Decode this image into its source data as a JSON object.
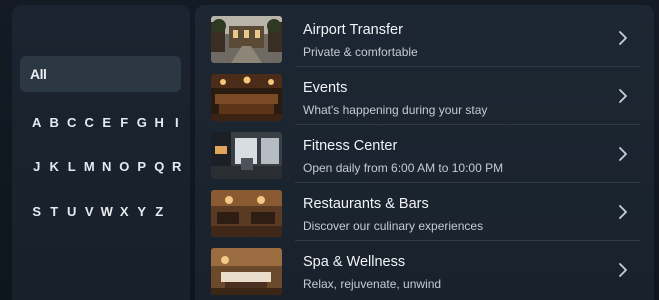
{
  "filter": {
    "all_label": "All",
    "rows": [
      [
        "A",
        "B",
        "C",
        "C",
        "E",
        "F",
        "G",
        "H",
        "I"
      ],
      [
        "J",
        "K",
        "L",
        "M",
        "N",
        "O",
        "P",
        "Q",
        "R"
      ],
      [
        "S",
        "T",
        "U",
        "V",
        "W",
        "X",
        "Y",
        "Z"
      ]
    ]
  },
  "items": [
    {
      "title": "Airport Transfer",
      "subtitle": "Private & comfortable",
      "thumb_icon": "hotel-courtyard-photo"
    },
    {
      "title": "Events",
      "subtitle": "What's happening during your stay",
      "thumb_icon": "ballroom-photo"
    },
    {
      "title": "Fitness Center",
      "subtitle": "Open daily from 6:00 AM to 10:00 PM",
      "thumb_icon": "gym-photo"
    },
    {
      "title": "Restaurants & Bars",
      "subtitle": "Discover our culinary experiences",
      "thumb_icon": "restaurant-photo"
    },
    {
      "title": "Spa & Wellness",
      "subtitle": "Relax, rejuvenate, unwind",
      "thumb_icon": "spa-photo"
    }
  ],
  "colors": {
    "background": "#0f151c",
    "panel": "#1b2430",
    "selected_filter": "#2c3744",
    "text": "#f1f4f7",
    "subtext": "#c4ccd5"
  }
}
